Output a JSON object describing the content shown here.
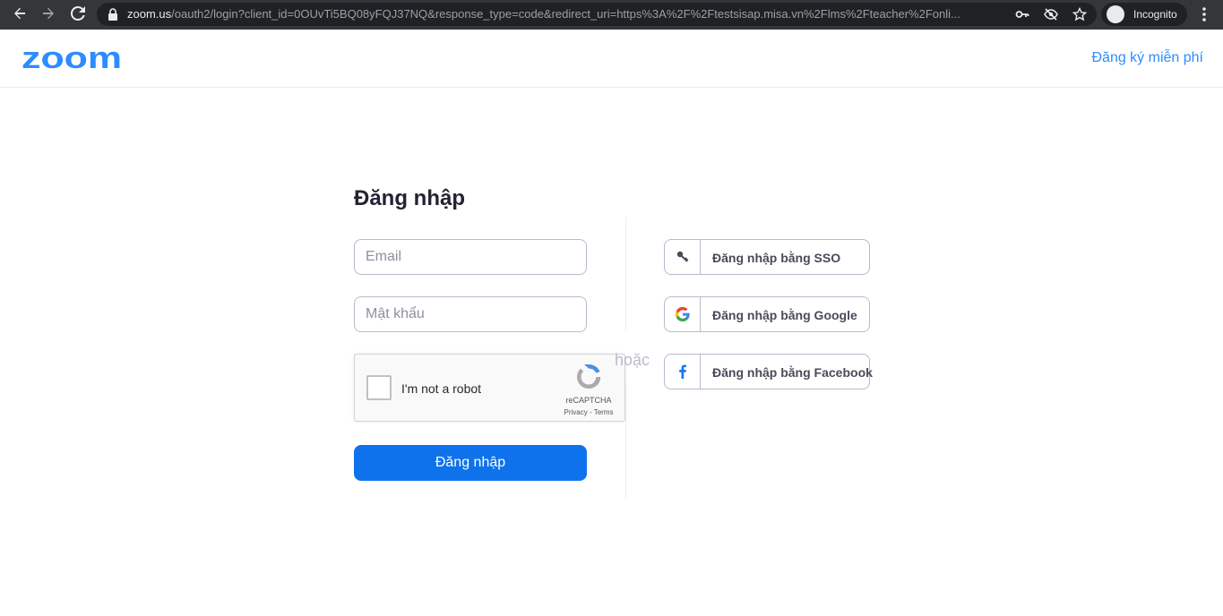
{
  "browser": {
    "url_host": "zoom.us",
    "url_rest": "/oauth2/login?client_id=0OUvTi5BQ08yFQJ37NQ&response_type=code&redirect_uri=https%3A%2F%2Ftestsisap.misa.vn%2Flms%2Fteacher%2Fonli...",
    "incognito_label": "Incognito"
  },
  "header": {
    "logo_text": "zoom",
    "signup_label": "Đăng ký miễn phí",
    "brand_color": "#2d8cff"
  },
  "login": {
    "title": "Đăng nhập",
    "email_placeholder": "Email",
    "password_placeholder": "Mật khẩu",
    "submit_label": "Đăng nhập",
    "or_label": "hoặc"
  },
  "captcha": {
    "label": "I'm not a robot",
    "brand": "reCAPTCHA",
    "links": "Privacy - Terms"
  },
  "alt_login": {
    "sso_label": "Đăng nhập bằng SSO",
    "google_label": "Đăng nhập bằng Google",
    "facebook_label": "Đăng nhập bằng Facebook"
  }
}
